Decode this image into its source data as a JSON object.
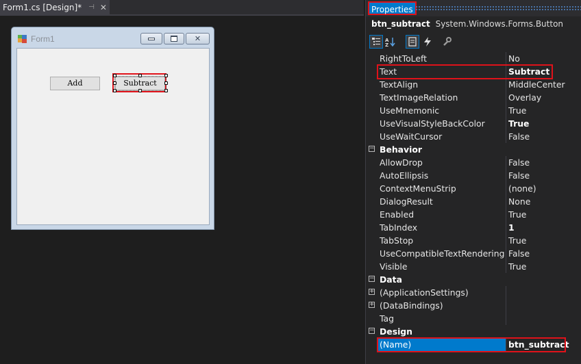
{
  "document_tab": {
    "title": "Form1.cs [Design]*",
    "pin_glyph": "⊣",
    "close_glyph": "✕"
  },
  "form": {
    "title": "Form1",
    "buttons": {
      "add": "Add",
      "subtract": "Subtract"
    }
  },
  "properties": {
    "title": "Properties",
    "object_name": "btn_subtract",
    "object_type": "System.Windows.Forms.Button",
    "toolbar": [
      "categorized-icon",
      "alphabetical-icon",
      "properties-icon",
      "events-icon",
      "property-pages-icon"
    ],
    "rows": [
      {
        "kind": "prop",
        "name": "RightToLeft",
        "value": "No",
        "bold": false
      },
      {
        "kind": "prop",
        "name": "Text",
        "value": "Subtract",
        "bold": true
      },
      {
        "kind": "prop",
        "name": "TextAlign",
        "value": "MiddleCenter",
        "bold": false
      },
      {
        "kind": "prop",
        "name": "TextImageRelation",
        "value": "Overlay",
        "bold": false
      },
      {
        "kind": "prop",
        "name": "UseMnemonic",
        "value": "True",
        "bold": false
      },
      {
        "kind": "prop",
        "name": "UseVisualStyleBackColor",
        "value": "True",
        "bold": true
      },
      {
        "kind": "prop",
        "name": "UseWaitCursor",
        "value": "False",
        "bold": false
      },
      {
        "kind": "cat",
        "name": "Behavior"
      },
      {
        "kind": "prop",
        "name": "AllowDrop",
        "value": "False",
        "bold": false
      },
      {
        "kind": "prop",
        "name": "AutoEllipsis",
        "value": "False",
        "bold": false
      },
      {
        "kind": "prop",
        "name": "ContextMenuStrip",
        "value": "(none)",
        "bold": false
      },
      {
        "kind": "prop",
        "name": "DialogResult",
        "value": "None",
        "bold": false
      },
      {
        "kind": "prop",
        "name": "Enabled",
        "value": "True",
        "bold": false
      },
      {
        "kind": "prop",
        "name": "TabIndex",
        "value": "1",
        "bold": true
      },
      {
        "kind": "prop",
        "name": "TabStop",
        "value": "True",
        "bold": false
      },
      {
        "kind": "prop",
        "name": "UseCompatibleTextRendering",
        "value": "False",
        "bold": false
      },
      {
        "kind": "prop",
        "name": "Visible",
        "value": "True",
        "bold": false
      },
      {
        "kind": "cat",
        "name": "Data"
      },
      {
        "kind": "prop",
        "name": "(ApplicationSettings)",
        "value": "",
        "bold": false,
        "expandable": true
      },
      {
        "kind": "prop",
        "name": "(DataBindings)",
        "value": "",
        "bold": false,
        "expandable": true
      },
      {
        "kind": "prop",
        "name": "Tag",
        "value": "",
        "bold": false
      },
      {
        "kind": "cat",
        "name": "Design"
      },
      {
        "kind": "prop",
        "name": "(Name)",
        "value": "btn_subtract",
        "bold": true,
        "selected": true
      }
    ]
  },
  "colors": {
    "accent": "#007acc",
    "highlight": "#e0121a"
  }
}
